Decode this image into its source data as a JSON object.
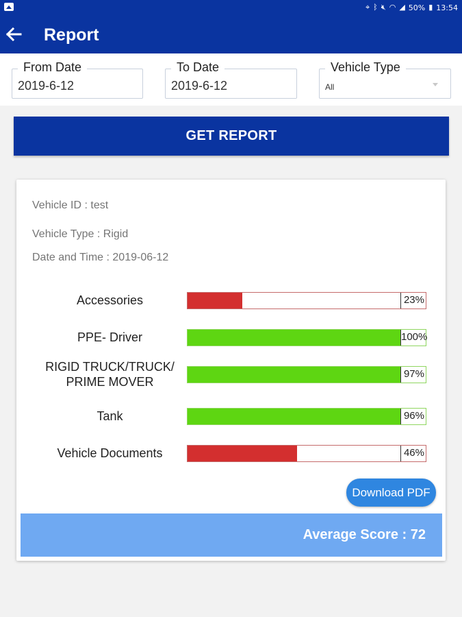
{
  "status_bar": {
    "icons": [
      "location-icon",
      "bluetooth-icon",
      "mute-icon",
      "wifi-icon",
      "signal-icon"
    ],
    "battery": "50%",
    "time": "13:54"
  },
  "app_bar": {
    "title": "Report",
    "back_icon": "arrow-left-icon",
    "color": "#0a34a0"
  },
  "filters": {
    "from_date": {
      "label": "From Date",
      "value": "2019-6-12"
    },
    "to_date": {
      "label": "To Date",
      "value": "2019-6-12"
    },
    "vehicle_type": {
      "label": "Vehicle Type",
      "value": "All"
    }
  },
  "get_report_label": "GET REPORT",
  "report": {
    "vehicle_id_label": "Vehicle ID :",
    "vehicle_id": "test",
    "vehicle_type_label": "Vehicle Type :",
    "vehicle_type": "Rigid",
    "datetime_label": "Date and Time :",
    "datetime": "2019-06-12",
    "items": [
      {
        "label": "Accessories",
        "percent": 23,
        "percent_text": "23%",
        "color": "#d32f2f"
      },
      {
        "label": "PPE- Driver",
        "percent": 100,
        "percent_text": "100%",
        "color": "#5ed612"
      },
      {
        "label": "RIGID TRUCK/TRUCK/\nPRIME MOVER",
        "percent": 97,
        "percent_text": "97%",
        "color": "#5ed612"
      },
      {
        "label": "Tank",
        "percent": 96,
        "percent_text": "96%",
        "color": "#5ed612"
      },
      {
        "label": "Vehicle Documents",
        "percent": 46,
        "percent_text": "46%",
        "color": "#d32f2f"
      }
    ],
    "download_label": "Download PDF",
    "average_label": "Average Score",
    "average_sep": ":",
    "average_value": "72"
  }
}
